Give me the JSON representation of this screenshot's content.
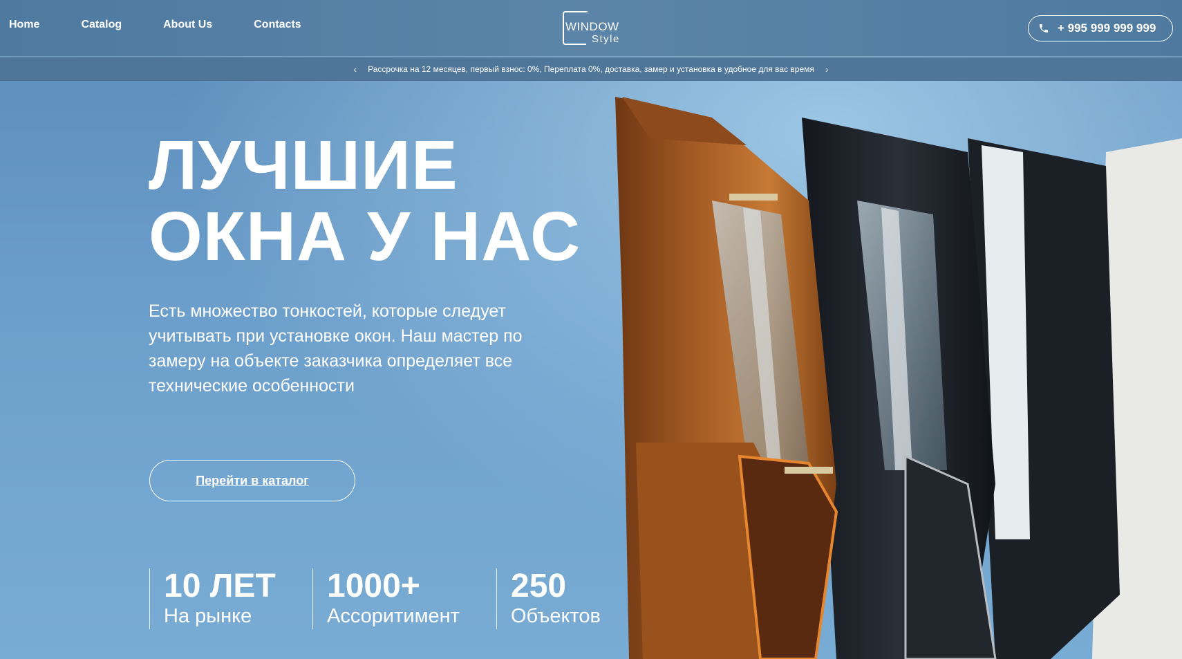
{
  "nav": {
    "items": [
      "Home",
      "Catalog",
      "About Us",
      "Contacts"
    ]
  },
  "logo": {
    "word": "WINDOW",
    "sub": "Style"
  },
  "phone": {
    "number": "+ 995 999 999 999"
  },
  "promo": {
    "text": "Рассрочка на 12 месяцев, первый взнос: 0%, Переплата 0%, доставка, замер и установка в удобное для вас время"
  },
  "hero": {
    "title_line1": "ЛУЧШИЕ",
    "title_line2": "ОКНА У НАС",
    "lead": "Есть множество тонкостей, которые следует учитывать при установке окон. Наш мастер по замеру на объекте заказчика определяет все технические особенности",
    "cta": "Перейти в каталог"
  },
  "stats": [
    {
      "value": "10 ЛЕТ",
      "label": "На рынке"
    },
    {
      "value": "1000+",
      "label": "Ассоритимент"
    },
    {
      "value": "250",
      "label": "Объектов"
    }
  ],
  "colors": {
    "header": "#4f7aa0",
    "promo_bar": "#4f7699",
    "hero": "#6c9ecb",
    "wood": "#8a4a1c",
    "dark_profile": "#1f232b"
  }
}
